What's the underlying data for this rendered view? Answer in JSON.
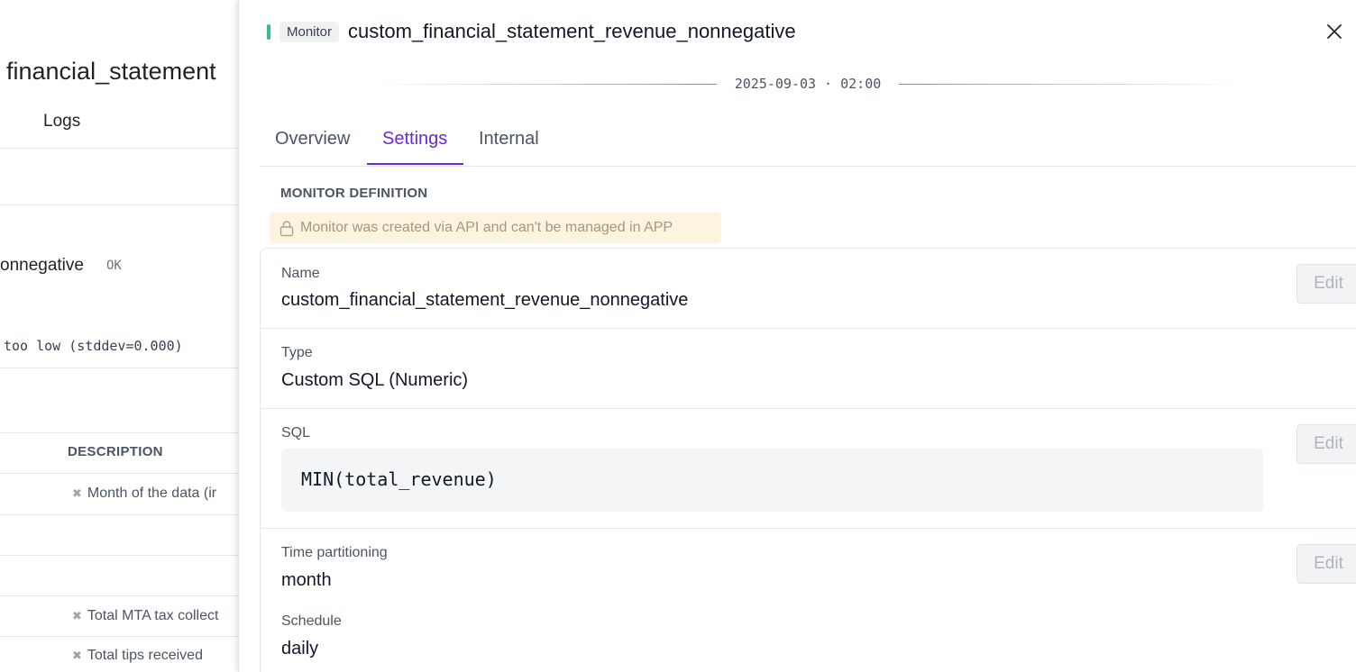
{
  "background": {
    "title": "financial_statement",
    "tab_logs": "Logs",
    "monitor_name_partial": "onnegative",
    "monitor_status": "OK",
    "message": "too low (stddev=0.000)",
    "columns_header": "DESCRIPTION",
    "rows": [
      {
        "description": "Month of the data (ir"
      },
      {
        "description": "Total MTA tax collect"
      },
      {
        "description": "Total tips received"
      }
    ]
  },
  "drawer": {
    "type_badge": "Monitor",
    "title": "custom_financial_statement_revenue_nonnegative",
    "timestamp": "2025-09-03 · 02:00",
    "tabs": [
      {
        "label": "Overview",
        "active": false
      },
      {
        "label": "Settings",
        "active": true
      },
      {
        "label": "Internal",
        "active": false
      }
    ],
    "section_title": "MONITOR DEFINITION",
    "lock_notice": "Monitor was created via API and can't be managed in APP",
    "fields": {
      "name": {
        "label": "Name",
        "value": "custom_financial_statement_revenue_nonnegative",
        "edit": "Edit"
      },
      "type": {
        "label": "Type",
        "value": "Custom SQL (Numeric)"
      },
      "sql": {
        "label": "SQL",
        "value": "MIN(total_revenue)",
        "edit": "Edit"
      },
      "time_partitioning": {
        "label": "Time partitioning",
        "value": "month",
        "edit": "Edit"
      },
      "schedule": {
        "label": "Schedule",
        "value": "daily"
      }
    },
    "colors": {
      "accent": "#6d28d9",
      "status": "#3fb68b",
      "notice_bg": "#fdf4df"
    }
  }
}
